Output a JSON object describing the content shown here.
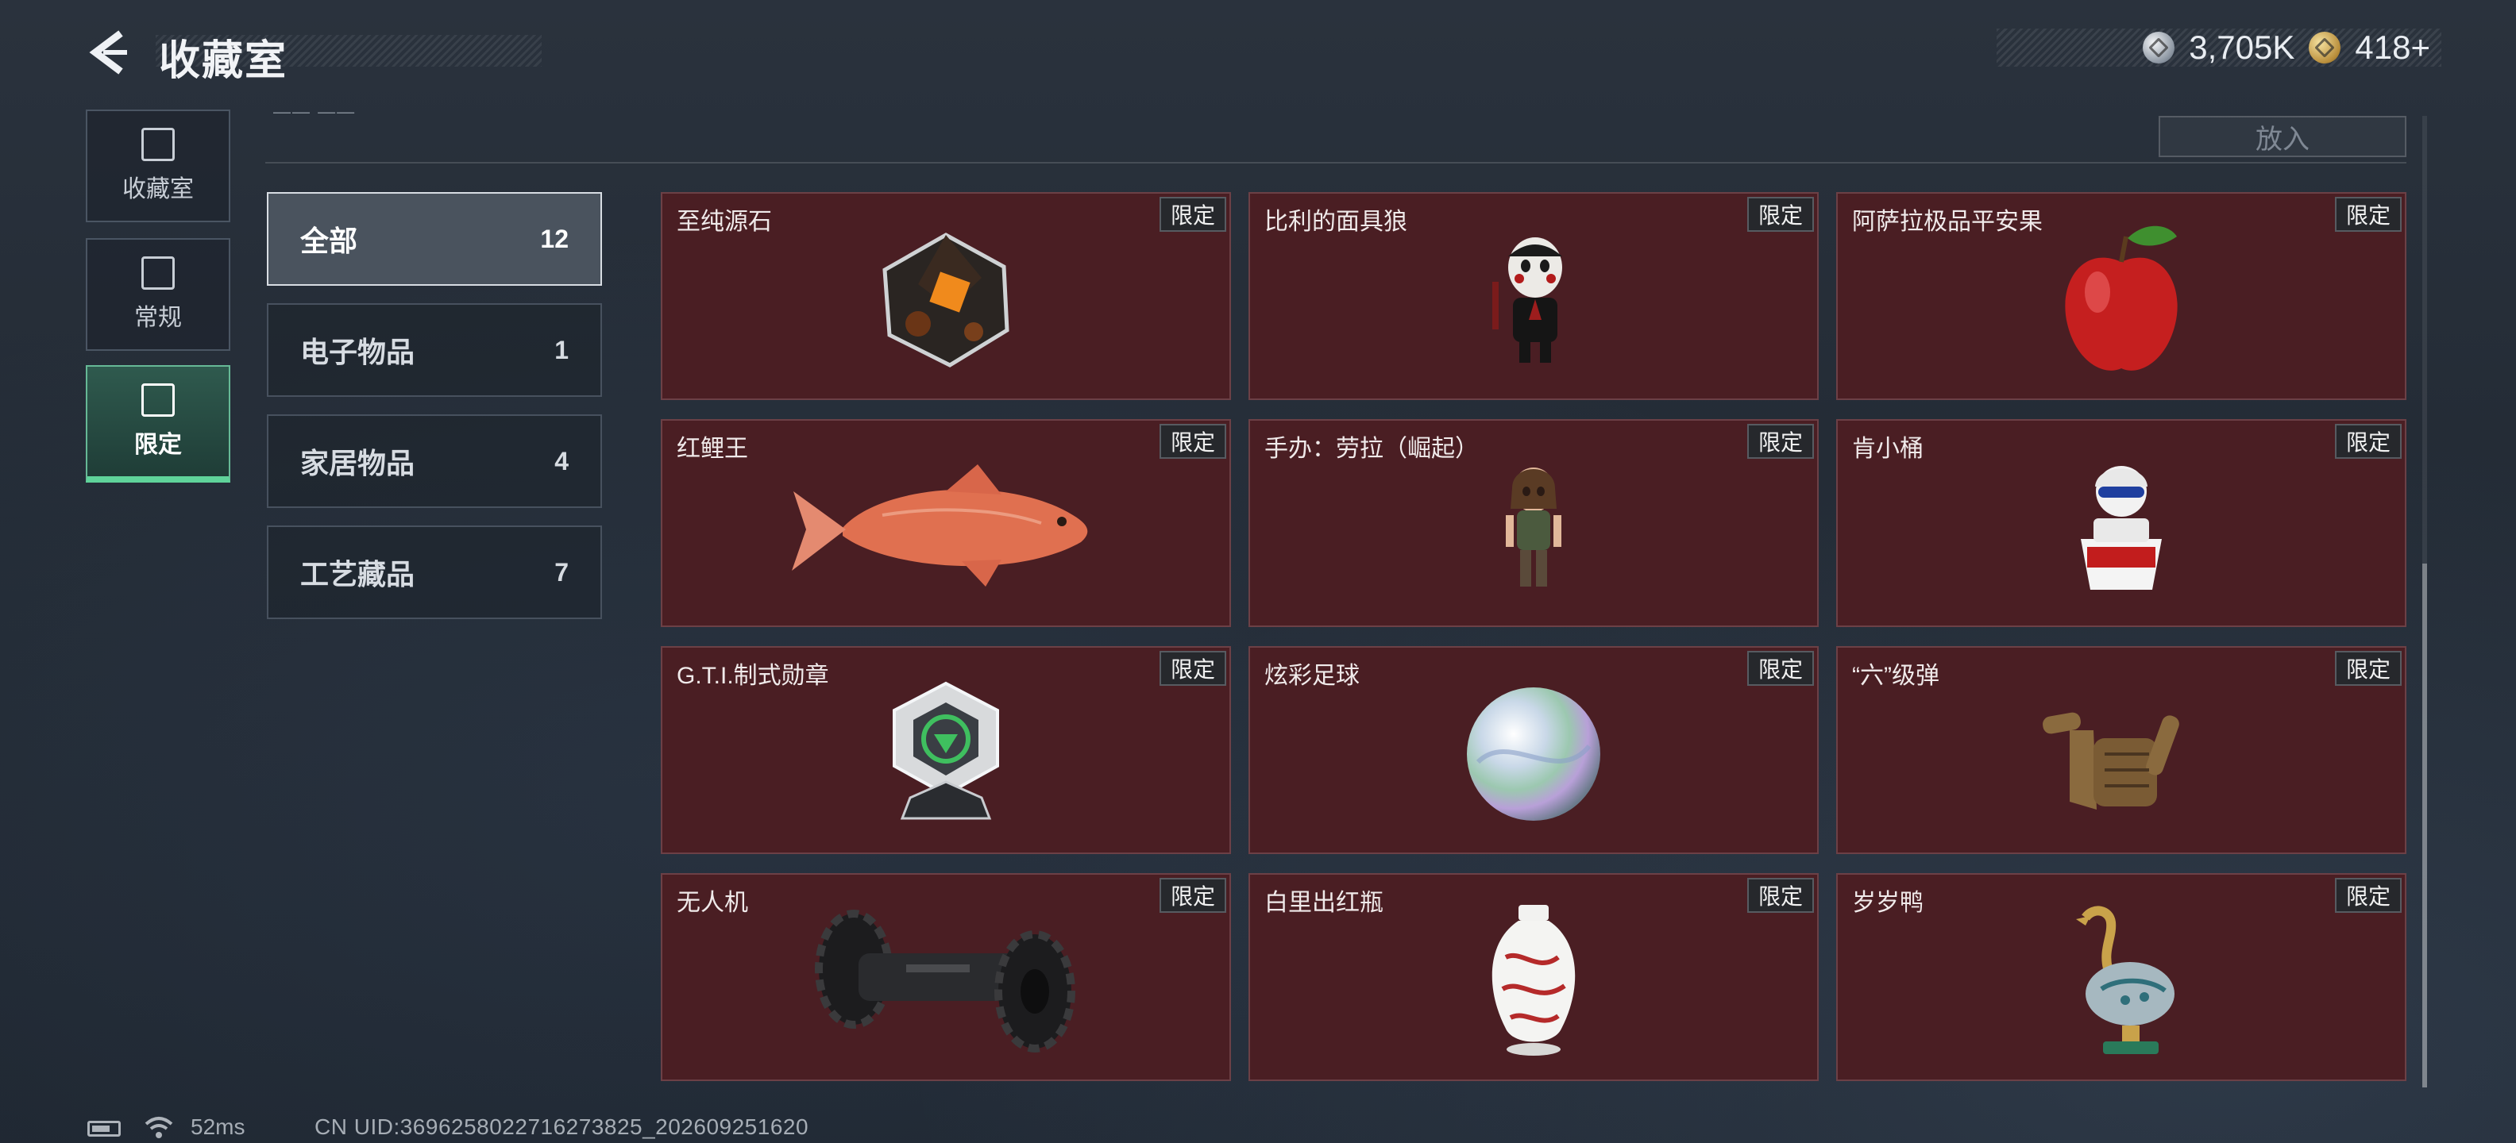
{
  "header": {
    "title": "收藏室"
  },
  "currency": {
    "silver": "3,705K",
    "gold": "418",
    "gold_plus": "+"
  },
  "nav": [
    {
      "label": "收藏室",
      "icon": "collection-icon"
    },
    {
      "label": "常规",
      "icon": "regular-icon"
    },
    {
      "label": "限定",
      "icon": "limited-icon"
    }
  ],
  "nav_active": "限定",
  "top_strip": {
    "button": "放入",
    "text": "—— ——"
  },
  "categories": [
    {
      "name": "全部",
      "count": "12"
    },
    {
      "name": "电子物品",
      "count": "1"
    },
    {
      "name": "家居物品",
      "count": "4"
    },
    {
      "name": "工艺藏品",
      "count": "7"
    }
  ],
  "category_active": "全部",
  "items": [
    {
      "name": "至纯源石",
      "tag": "限定"
    },
    {
      "name": "比利的面具狼",
      "tag": "限定"
    },
    {
      "name": "阿萨拉极品平安果",
      "tag": "限定"
    },
    {
      "name": "红鲤王",
      "tag": "限定"
    },
    {
      "name": "手办：劳拉（崛起）",
      "tag": "限定"
    },
    {
      "name": "肯小桶",
      "tag": "限定"
    },
    {
      "name": "G.T.I.制式勋章",
      "tag": "限定"
    },
    {
      "name": "炫彩足球",
      "tag": "限定"
    },
    {
      "name": "“六”级弹",
      "tag": "限定"
    },
    {
      "name": "无人机",
      "tag": "限定"
    },
    {
      "name": "白里出红瓶",
      "tag": "限定"
    },
    {
      "name": "岁岁鸭",
      "tag": "限定"
    }
  ],
  "footer": {
    "ping": "52ms",
    "uid": "CN UID:3696258022716273825_202609251620"
  },
  "colors": {
    "card_bg": "#4a1e23",
    "accent_green": "#5fd39a"
  }
}
